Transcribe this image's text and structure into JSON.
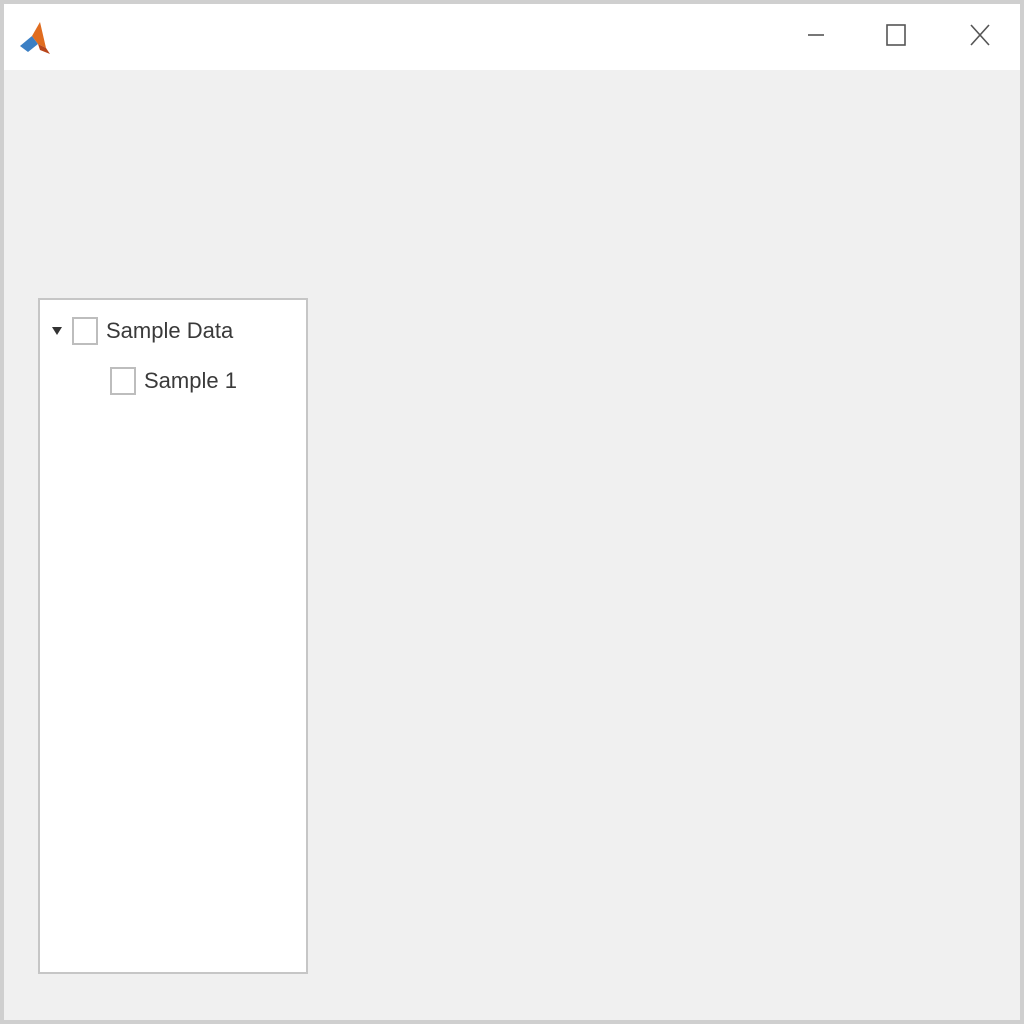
{
  "window": {
    "title": "",
    "icon": "matlab-logo-icon",
    "controls": {
      "minimize_icon": "minimize-icon",
      "maximize_icon": "maximize-icon",
      "close_icon": "close-icon"
    }
  },
  "tree": {
    "root": {
      "label": "Sample Data",
      "expanded": true,
      "checked": false,
      "children": [
        {
          "label": "Sample 1",
          "checked": false
        }
      ]
    }
  },
  "colors": {
    "window_bg": "#f0f0f0",
    "titlebar_bg": "#ffffff",
    "tree_bg": "#ffffff",
    "border": "#c6c6c6"
  }
}
